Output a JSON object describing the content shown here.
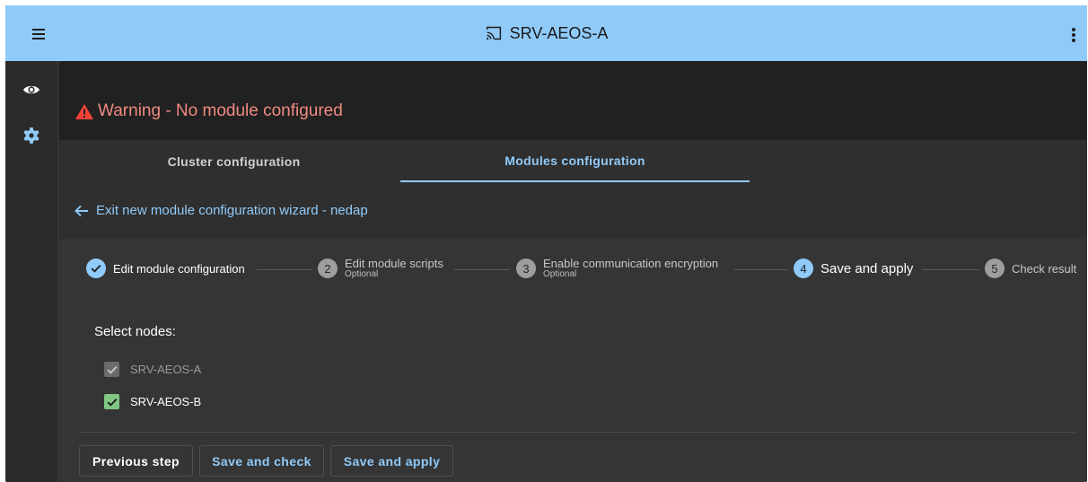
{
  "topbar": {
    "title": "SRV-AEOS-A",
    "menu_icon": "menu-icon",
    "cast_icon": "cast-icon",
    "more_icon": "more-vert-icon",
    "background": "#90caf9"
  },
  "sidenav": {
    "items": [
      {
        "icon": "eye-icon"
      },
      {
        "icon": "gear-icon"
      }
    ]
  },
  "warning": {
    "icon": "warning-icon",
    "text": "Warning - No module configured",
    "color": "#ef8a80"
  },
  "tabs": [
    {
      "label": "Cluster configuration",
      "active": false
    },
    {
      "label": "Modules configuration",
      "active": true
    }
  ],
  "wizard": {
    "exit_label": "Exit new module configuration wizard - nedap",
    "accent": "#90caf9",
    "steps": [
      {
        "number": "1",
        "label": "Edit module configuration",
        "sublabel": "",
        "state": "done"
      },
      {
        "number": "2",
        "label": "Edit module scripts",
        "sublabel": "Optional",
        "state": "idle"
      },
      {
        "number": "3",
        "label": "Enable communication encryption",
        "sublabel": "Optional",
        "state": "idle"
      },
      {
        "number": "4",
        "label": "Save and apply",
        "sublabel": "",
        "state": "active"
      },
      {
        "number": "5",
        "label": "Check result",
        "sublabel": "",
        "state": "idle"
      }
    ]
  },
  "nodes": {
    "label": "Select nodes:",
    "items": [
      {
        "name": "SRV-AEOS-A",
        "checked": true,
        "disabled": true
      },
      {
        "name": "SRV-AEOS-B",
        "checked": true,
        "disabled": false
      }
    ],
    "checked_color": "#81c784"
  },
  "actions": {
    "previous": "Previous step",
    "save_check": "Save and check",
    "save_apply": "Save and apply"
  }
}
